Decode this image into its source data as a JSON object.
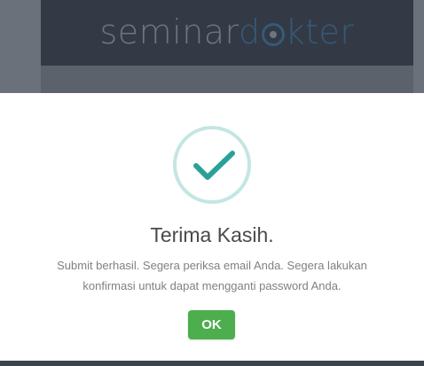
{
  "logo": {
    "part1": "seminar",
    "part2_a": "d",
    "part2_b": "kter"
  },
  "dialog": {
    "icon": "checkmark-icon",
    "title": "Terima Kasih.",
    "message": "Submit berhasil. Segera periksa email Anda. Segera lakukan konfirmasi untuk dapat mengganti password Anda.",
    "ok_label": "OK"
  },
  "colors": {
    "accent": "#2aa198",
    "icon_ring": "#c4e6e3",
    "ok_button": "#4cae4c",
    "header": "#333a45"
  }
}
